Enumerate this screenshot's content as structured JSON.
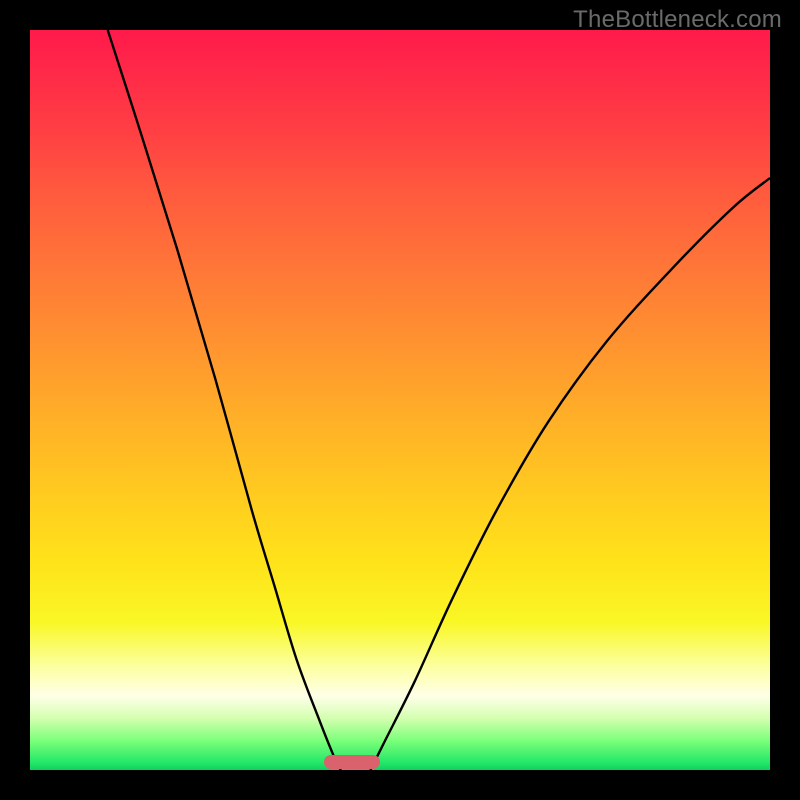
{
  "watermark": "TheBottleneck.com",
  "chart_data": {
    "type": "line",
    "title": "",
    "xlabel": "",
    "ylabel": "",
    "xlim": [
      0,
      1
    ],
    "ylim": [
      0,
      1
    ],
    "grid": false,
    "legend": false,
    "description": "V-shaped bottleneck curve over red-to-green vertical gradient background. Two black curves descend from top edges to a common minimum near x≈0.42, y≈0.",
    "series": [
      {
        "name": "left-branch",
        "x": [
          0.105,
          0.15,
          0.2,
          0.25,
          0.3,
          0.33,
          0.36,
          0.39,
          0.41,
          0.42
        ],
        "y": [
          1.0,
          0.86,
          0.7,
          0.53,
          0.35,
          0.25,
          0.15,
          0.07,
          0.02,
          0.0
        ]
      },
      {
        "name": "right-branch",
        "x": [
          0.46,
          0.48,
          0.52,
          0.57,
          0.63,
          0.7,
          0.78,
          0.87,
          0.95,
          1.0
        ],
        "y": [
          0.0,
          0.04,
          0.12,
          0.23,
          0.35,
          0.47,
          0.58,
          0.68,
          0.76,
          0.8
        ]
      }
    ],
    "gradient_stops": [
      {
        "pos": 0.0,
        "color": "#ff1a4b"
      },
      {
        "pos": 0.32,
        "color": "#ff7638"
      },
      {
        "pos": 0.62,
        "color": "#ffc920"
      },
      {
        "pos": 0.86,
        "color": "#fcffa0"
      },
      {
        "pos": 0.96,
        "color": "#7dff7a"
      },
      {
        "pos": 1.0,
        "color": "#10d060"
      }
    ],
    "marker": {
      "x_center": 0.435,
      "y": 0.0,
      "width_frac": 0.075,
      "color": "#d9626c"
    }
  }
}
